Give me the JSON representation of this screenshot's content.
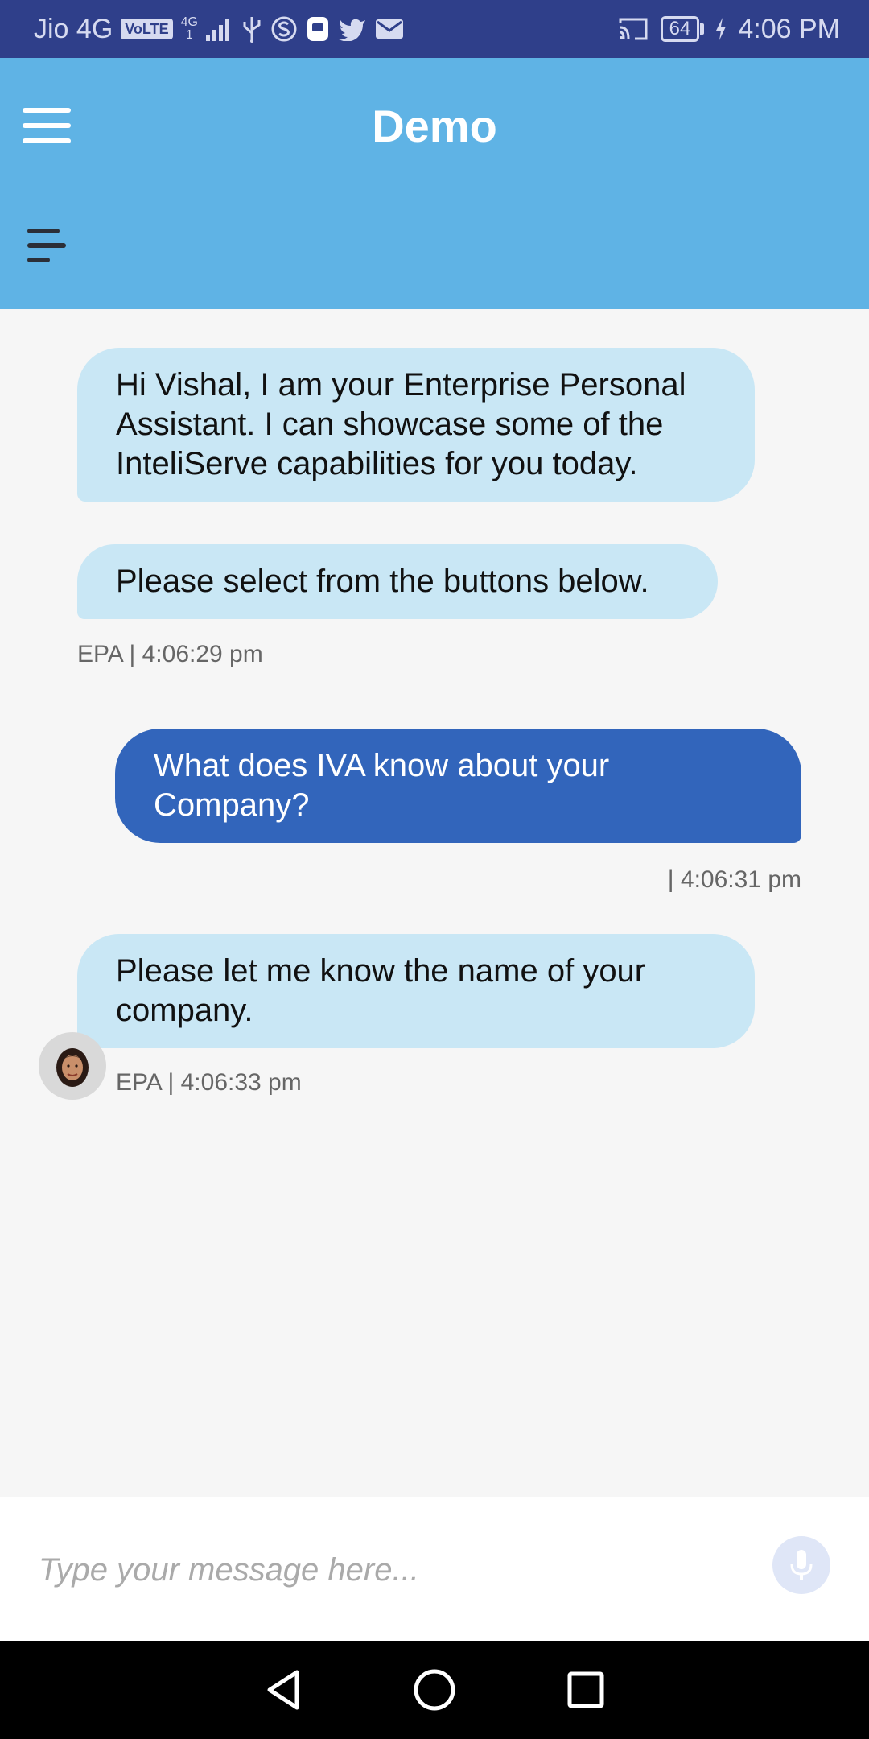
{
  "status_bar": {
    "carrier": "Jio 4G",
    "volte_badge": "VoLTE",
    "network_top": "4G",
    "network_bottom": "1",
    "battery": "64",
    "time": "4:06 PM"
  },
  "header": {
    "title": "Demo"
  },
  "chat": {
    "messages": [
      {
        "sender": "bot",
        "text": "Hi Vishal, I am your Enterprise Personal Assistant. I can showcase some of the InteliServe capabilities for you today."
      },
      {
        "sender": "bot",
        "text": "Please select from the buttons below."
      },
      {
        "sender": "user",
        "text": "What does IVA know about your Company?"
      },
      {
        "sender": "bot",
        "text": "Please let me know the name of your company."
      }
    ],
    "meta": {
      "bot_1": "EPA | 4:06:29 pm",
      "user_1": "| 4:06:31 pm",
      "bot_2": "EPA | 4:06:33 pm"
    }
  },
  "composer": {
    "placeholder": "Type your message here..."
  },
  "colors": {
    "status_bar": "#2f3f8a",
    "app_bar": "#5fb3e5",
    "bot_bubble": "#c9e7f5",
    "user_bubble": "#3265bb",
    "background": "#f6f6f6"
  },
  "icons": [
    "menu-icon",
    "sub-menu-icon",
    "mic-icon",
    "back-icon",
    "home-icon",
    "recents-icon",
    "signal-icon",
    "usb-icon",
    "skype-icon",
    "app-icon",
    "twitter-icon",
    "mail-icon",
    "cast-icon",
    "charging-icon"
  ]
}
